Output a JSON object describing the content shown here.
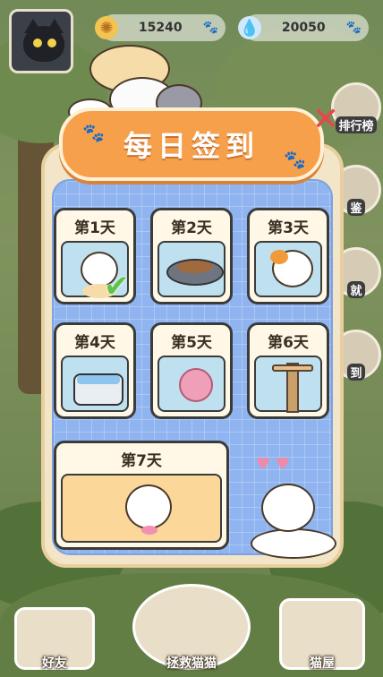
{
  "resources": [
    {
      "name": "coins",
      "icon": "sun-coin-icon",
      "value": "15240",
      "color": "#e8a83a"
    },
    {
      "name": "water",
      "icon": "water-drop-icon",
      "value": "20050",
      "color": "#4aa3e8"
    }
  ],
  "side_buttons": [
    {
      "icon": "leaderboard-icon",
      "label": "排行榜"
    },
    {
      "icon": "handbook-icon",
      "label": "鉴"
    },
    {
      "icon": "achievement-icon",
      "label": "就"
    },
    {
      "icon": "signin-icon",
      "label": "到"
    }
  ],
  "dialog": {
    "title": "每日签到",
    "days": [
      {
        "label": "第1天",
        "reward": "cat",
        "claimed": true
      },
      {
        "label": "第2天",
        "reward": "food-bowl",
        "claimed": false
      },
      {
        "label": "第3天",
        "reward": "calico-cat",
        "claimed": false
      },
      {
        "label": "第4天",
        "reward": "canned-food",
        "claimed": false
      },
      {
        "label": "第5天",
        "reward": "yarn-ball",
        "claimed": false
      },
      {
        "label": "第6天",
        "reward": "cat-tree",
        "claimed": false
      },
      {
        "label": "第7天",
        "reward": "ragdoll-cat",
        "claimed": false
      }
    ]
  },
  "bottom_nav": [
    {
      "icon": "friends-icon",
      "label": "好友"
    },
    {
      "icon": "rescue-cat-icon",
      "label": "拯救猫猫"
    },
    {
      "icon": "cat-house-icon",
      "label": "猫屋"
    }
  ],
  "colors": {
    "accent": "#f7a04b",
    "panel": "#8fb4f0",
    "close": "#e8474a",
    "check": "#5fc24a"
  }
}
